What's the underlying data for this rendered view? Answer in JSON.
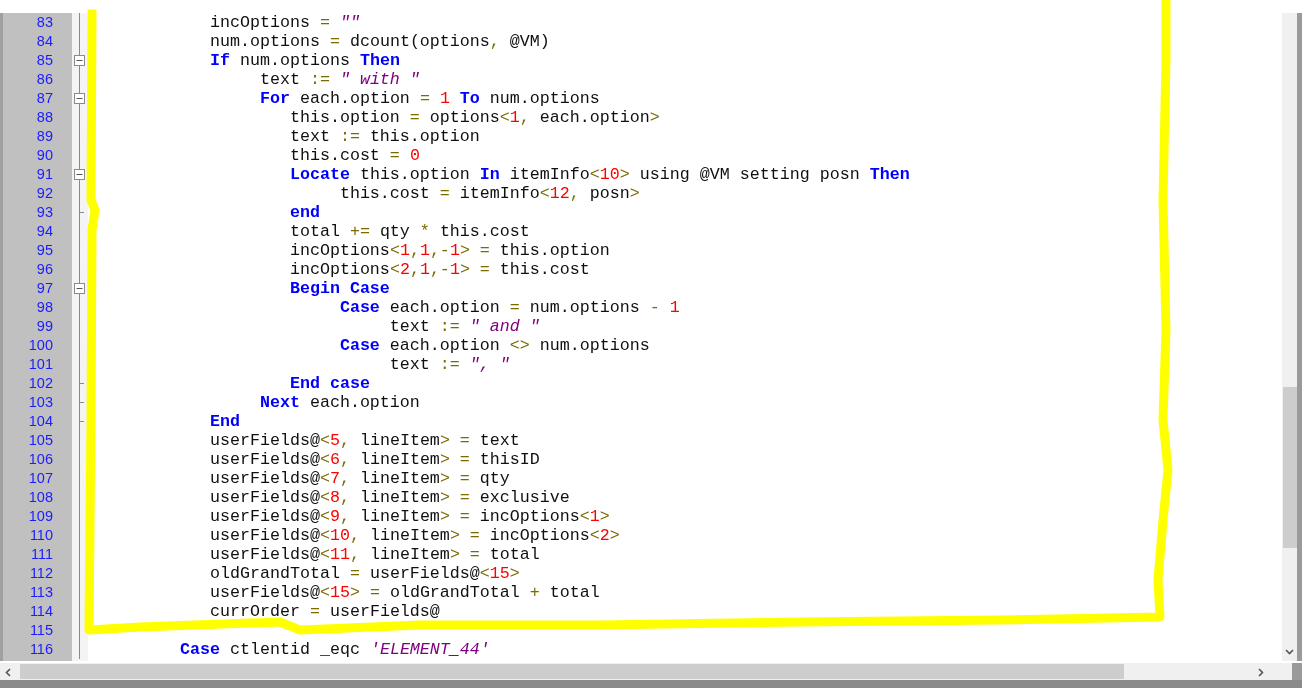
{
  "editor": {
    "lines": [
      {
        "number": "83",
        "foldable": false,
        "fold_end": false,
        "tokens": [
          {
            "kind": "id",
            "text": "            incOptions"
          },
          {
            "kind": "op",
            "text": " = "
          },
          {
            "kind": "str",
            "text": "\"\""
          }
        ]
      },
      {
        "number": "84",
        "foldable": false,
        "fold_end": false,
        "tokens": [
          {
            "kind": "id",
            "text": "            num.options"
          },
          {
            "kind": "op",
            "text": " = "
          },
          {
            "kind": "id",
            "text": "dcount(options"
          },
          {
            "kind": "op",
            "text": ", "
          },
          {
            "kind": "id",
            "text": "@VM)"
          }
        ]
      },
      {
        "number": "85",
        "foldable": true,
        "fold_end": false,
        "tokens": [
          {
            "kind": "kw",
            "text": "            If"
          },
          {
            "kind": "id",
            "text": " num.options "
          },
          {
            "kind": "kw",
            "text": "Then"
          }
        ]
      },
      {
        "number": "86",
        "foldable": false,
        "fold_end": false,
        "tokens": [
          {
            "kind": "id",
            "text": "                 text"
          },
          {
            "kind": "op",
            "text": " := "
          },
          {
            "kind": "str",
            "text": "\" with \""
          }
        ]
      },
      {
        "number": "87",
        "foldable": true,
        "fold_end": false,
        "tokens": [
          {
            "kind": "kw",
            "text": "                 For"
          },
          {
            "kind": "id",
            "text": " each.option "
          },
          {
            "kind": "op",
            "text": "= "
          },
          {
            "kind": "num",
            "text": "1"
          },
          {
            "kind": "kw",
            "text": " To"
          },
          {
            "kind": "id",
            "text": " num.options"
          }
        ]
      },
      {
        "number": "88",
        "foldable": false,
        "fold_end": false,
        "tokens": [
          {
            "kind": "id",
            "text": "                    this.option"
          },
          {
            "kind": "op",
            "text": " = "
          },
          {
            "kind": "id",
            "text": "options"
          },
          {
            "kind": "op",
            "text": "<"
          },
          {
            "kind": "num",
            "text": "1"
          },
          {
            "kind": "op",
            "text": ", "
          },
          {
            "kind": "id",
            "text": "each.option"
          },
          {
            "kind": "op",
            "text": ">"
          }
        ]
      },
      {
        "number": "89",
        "foldable": false,
        "fold_end": false,
        "tokens": [
          {
            "kind": "id",
            "text": "                    text"
          },
          {
            "kind": "op",
            "text": " := "
          },
          {
            "kind": "id",
            "text": "this.option"
          }
        ]
      },
      {
        "number": "90",
        "foldable": false,
        "fold_end": false,
        "tokens": [
          {
            "kind": "id",
            "text": "                    this.cost"
          },
          {
            "kind": "op",
            "text": " = "
          },
          {
            "kind": "num",
            "text": "0"
          }
        ]
      },
      {
        "number": "91",
        "foldable": true,
        "fold_end": false,
        "tokens": [
          {
            "kind": "kw",
            "text": "                    Locate"
          },
          {
            "kind": "id",
            "text": " this.option "
          },
          {
            "kind": "kw",
            "text": "In"
          },
          {
            "kind": "id",
            "text": " itemInfo"
          },
          {
            "kind": "op",
            "text": "<"
          },
          {
            "kind": "num",
            "text": "10"
          },
          {
            "kind": "op",
            "text": ">"
          },
          {
            "kind": "id",
            "text": " using @VM setting posn "
          },
          {
            "kind": "kw",
            "text": "Then"
          }
        ]
      },
      {
        "number": "92",
        "foldable": false,
        "fold_end": false,
        "tokens": [
          {
            "kind": "id",
            "text": "                         this.cost"
          },
          {
            "kind": "op",
            "text": " = "
          },
          {
            "kind": "id",
            "text": "itemInfo"
          },
          {
            "kind": "op",
            "text": "<"
          },
          {
            "kind": "num",
            "text": "12"
          },
          {
            "kind": "op",
            "text": ", "
          },
          {
            "kind": "id",
            "text": "posn"
          },
          {
            "kind": "op",
            "text": ">"
          }
        ]
      },
      {
        "number": "93",
        "foldable": false,
        "fold_end": true,
        "tokens": [
          {
            "kind": "kw",
            "text": "                    end"
          }
        ]
      },
      {
        "number": "94",
        "foldable": false,
        "fold_end": false,
        "tokens": [
          {
            "kind": "id",
            "text": "                    total"
          },
          {
            "kind": "op",
            "text": " += "
          },
          {
            "kind": "id",
            "text": "qty"
          },
          {
            "kind": "op",
            "text": " * "
          },
          {
            "kind": "id",
            "text": "this.cost"
          }
        ]
      },
      {
        "number": "95",
        "foldable": false,
        "fold_end": false,
        "tokens": [
          {
            "kind": "id",
            "text": "                    incOptions"
          },
          {
            "kind": "op",
            "text": "<"
          },
          {
            "kind": "num",
            "text": "1"
          },
          {
            "kind": "op",
            "text": ","
          },
          {
            "kind": "num",
            "text": "1"
          },
          {
            "kind": "op",
            "text": ",-"
          },
          {
            "kind": "num",
            "text": "1"
          },
          {
            "kind": "op",
            "text": "> = "
          },
          {
            "kind": "id",
            "text": "this.option"
          }
        ]
      },
      {
        "number": "96",
        "foldable": false,
        "fold_end": false,
        "tokens": [
          {
            "kind": "id",
            "text": "                    incOptions"
          },
          {
            "kind": "op",
            "text": "<"
          },
          {
            "kind": "num",
            "text": "2"
          },
          {
            "kind": "op",
            "text": ","
          },
          {
            "kind": "num",
            "text": "1"
          },
          {
            "kind": "op",
            "text": ",-"
          },
          {
            "kind": "num",
            "text": "1"
          },
          {
            "kind": "op",
            "text": "> = "
          },
          {
            "kind": "id",
            "text": "this.cost"
          }
        ]
      },
      {
        "number": "97",
        "foldable": true,
        "fold_end": false,
        "tokens": [
          {
            "kind": "kw",
            "text": "                    Begin Case"
          }
        ]
      },
      {
        "number": "98",
        "foldable": false,
        "fold_end": false,
        "tokens": [
          {
            "kind": "kw",
            "text": "                         Case"
          },
          {
            "kind": "id",
            "text": " each.option "
          },
          {
            "kind": "op",
            "text": "= "
          },
          {
            "kind": "id",
            "text": "num.options "
          },
          {
            "kind": "op",
            "text": "- "
          },
          {
            "kind": "num",
            "text": "1"
          }
        ]
      },
      {
        "number": "99",
        "foldable": false,
        "fold_end": false,
        "tokens": [
          {
            "kind": "id",
            "text": "                              text"
          },
          {
            "kind": "op",
            "text": " := "
          },
          {
            "kind": "str",
            "text": "\" and \""
          }
        ]
      },
      {
        "number": "100",
        "foldable": false,
        "fold_end": false,
        "tokens": [
          {
            "kind": "kw",
            "text": "                         Case"
          },
          {
            "kind": "id",
            "text": " each.option "
          },
          {
            "kind": "op",
            "text": "<> "
          },
          {
            "kind": "id",
            "text": "num.options"
          }
        ]
      },
      {
        "number": "101",
        "foldable": false,
        "fold_end": false,
        "tokens": [
          {
            "kind": "id",
            "text": "                              text"
          },
          {
            "kind": "op",
            "text": " := "
          },
          {
            "kind": "str",
            "text": "\", \""
          }
        ]
      },
      {
        "number": "102",
        "foldable": false,
        "fold_end": true,
        "tokens": [
          {
            "kind": "kw",
            "text": "                    End case"
          }
        ]
      },
      {
        "number": "103",
        "foldable": false,
        "fold_end": true,
        "tokens": [
          {
            "kind": "kw",
            "text": "                 Next"
          },
          {
            "kind": "id",
            "text": " each.option"
          }
        ]
      },
      {
        "number": "104",
        "foldable": false,
        "fold_end": true,
        "tokens": [
          {
            "kind": "kw",
            "text": "            End"
          }
        ]
      },
      {
        "number": "105",
        "foldable": false,
        "fold_end": false,
        "tokens": [
          {
            "kind": "id",
            "text": "            userFields@"
          },
          {
            "kind": "op",
            "text": "<"
          },
          {
            "kind": "num",
            "text": "5"
          },
          {
            "kind": "op",
            "text": ", "
          },
          {
            "kind": "id",
            "text": "lineItem"
          },
          {
            "kind": "op",
            "text": "> = "
          },
          {
            "kind": "id",
            "text": "text"
          }
        ]
      },
      {
        "number": "106",
        "foldable": false,
        "fold_end": false,
        "tokens": [
          {
            "kind": "id",
            "text": "            userFields@"
          },
          {
            "kind": "op",
            "text": "<"
          },
          {
            "kind": "num",
            "text": "6"
          },
          {
            "kind": "op",
            "text": ", "
          },
          {
            "kind": "id",
            "text": "lineItem"
          },
          {
            "kind": "op",
            "text": "> = "
          },
          {
            "kind": "id",
            "text": "thisID"
          }
        ]
      },
      {
        "number": "107",
        "foldable": false,
        "fold_end": false,
        "tokens": [
          {
            "kind": "id",
            "text": "            userFields@"
          },
          {
            "kind": "op",
            "text": "<"
          },
          {
            "kind": "num",
            "text": "7"
          },
          {
            "kind": "op",
            "text": ", "
          },
          {
            "kind": "id",
            "text": "lineItem"
          },
          {
            "kind": "op",
            "text": "> = "
          },
          {
            "kind": "id",
            "text": "qty"
          }
        ]
      },
      {
        "number": "108",
        "foldable": false,
        "fold_end": false,
        "tokens": [
          {
            "kind": "id",
            "text": "            userFields@"
          },
          {
            "kind": "op",
            "text": "<"
          },
          {
            "kind": "num",
            "text": "8"
          },
          {
            "kind": "op",
            "text": ", "
          },
          {
            "kind": "id",
            "text": "lineItem"
          },
          {
            "kind": "op",
            "text": "> = "
          },
          {
            "kind": "id",
            "text": "exclusive"
          }
        ]
      },
      {
        "number": "109",
        "foldable": false,
        "fold_end": false,
        "tokens": [
          {
            "kind": "id",
            "text": "            userFields@"
          },
          {
            "kind": "op",
            "text": "<"
          },
          {
            "kind": "num",
            "text": "9"
          },
          {
            "kind": "op",
            "text": ", "
          },
          {
            "kind": "id",
            "text": "lineItem"
          },
          {
            "kind": "op",
            "text": "> = "
          },
          {
            "kind": "id",
            "text": "incOptions"
          },
          {
            "kind": "op",
            "text": "<"
          },
          {
            "kind": "num",
            "text": "1"
          },
          {
            "kind": "op",
            "text": ">"
          }
        ]
      },
      {
        "number": "110",
        "foldable": false,
        "fold_end": false,
        "tokens": [
          {
            "kind": "id",
            "text": "            userFields@"
          },
          {
            "kind": "op",
            "text": "<"
          },
          {
            "kind": "num",
            "text": "10"
          },
          {
            "kind": "op",
            "text": ", "
          },
          {
            "kind": "id",
            "text": "lineItem"
          },
          {
            "kind": "op",
            "text": "> = "
          },
          {
            "kind": "id",
            "text": "incOptions"
          },
          {
            "kind": "op",
            "text": "<"
          },
          {
            "kind": "num",
            "text": "2"
          },
          {
            "kind": "op",
            "text": ">"
          }
        ]
      },
      {
        "number": "111",
        "foldable": false,
        "fold_end": false,
        "tokens": [
          {
            "kind": "id",
            "text": "            userFields@"
          },
          {
            "kind": "op",
            "text": "<"
          },
          {
            "kind": "num",
            "text": "11"
          },
          {
            "kind": "op",
            "text": ", "
          },
          {
            "kind": "id",
            "text": "lineItem"
          },
          {
            "kind": "op",
            "text": "> = "
          },
          {
            "kind": "id",
            "text": "total"
          }
        ]
      },
      {
        "number": "112",
        "foldable": false,
        "fold_end": false,
        "tokens": [
          {
            "kind": "id",
            "text": "            oldGrandTotal"
          },
          {
            "kind": "op",
            "text": " = "
          },
          {
            "kind": "id",
            "text": "userFields@"
          },
          {
            "kind": "op",
            "text": "<"
          },
          {
            "kind": "num",
            "text": "15"
          },
          {
            "kind": "op",
            "text": ">"
          }
        ]
      },
      {
        "number": "113",
        "foldable": false,
        "fold_end": false,
        "tokens": [
          {
            "kind": "id",
            "text": "            userFields@"
          },
          {
            "kind": "op",
            "text": "<"
          },
          {
            "kind": "num",
            "text": "15"
          },
          {
            "kind": "op",
            "text": "> = "
          },
          {
            "kind": "id",
            "text": "oldGrandTotal"
          },
          {
            "kind": "op",
            "text": " + "
          },
          {
            "kind": "id",
            "text": "total"
          }
        ]
      },
      {
        "number": "114",
        "foldable": false,
        "fold_end": false,
        "tokens": [
          {
            "kind": "id",
            "text": "            currOrder"
          },
          {
            "kind": "op",
            "text": " = "
          },
          {
            "kind": "id",
            "text": "userFields@"
          }
        ]
      },
      {
        "number": "115",
        "foldable": false,
        "fold_end": false
      },
      {
        "number": "116",
        "foldable": false,
        "fold_end": false,
        "tokens": [
          {
            "kind": "kw",
            "text": "         Case"
          },
          {
            "kind": "id",
            "text": " ctlentid _eqc "
          },
          {
            "kind": "str",
            "text": "'ELEMENT_44'"
          }
        ]
      }
    ]
  }
}
